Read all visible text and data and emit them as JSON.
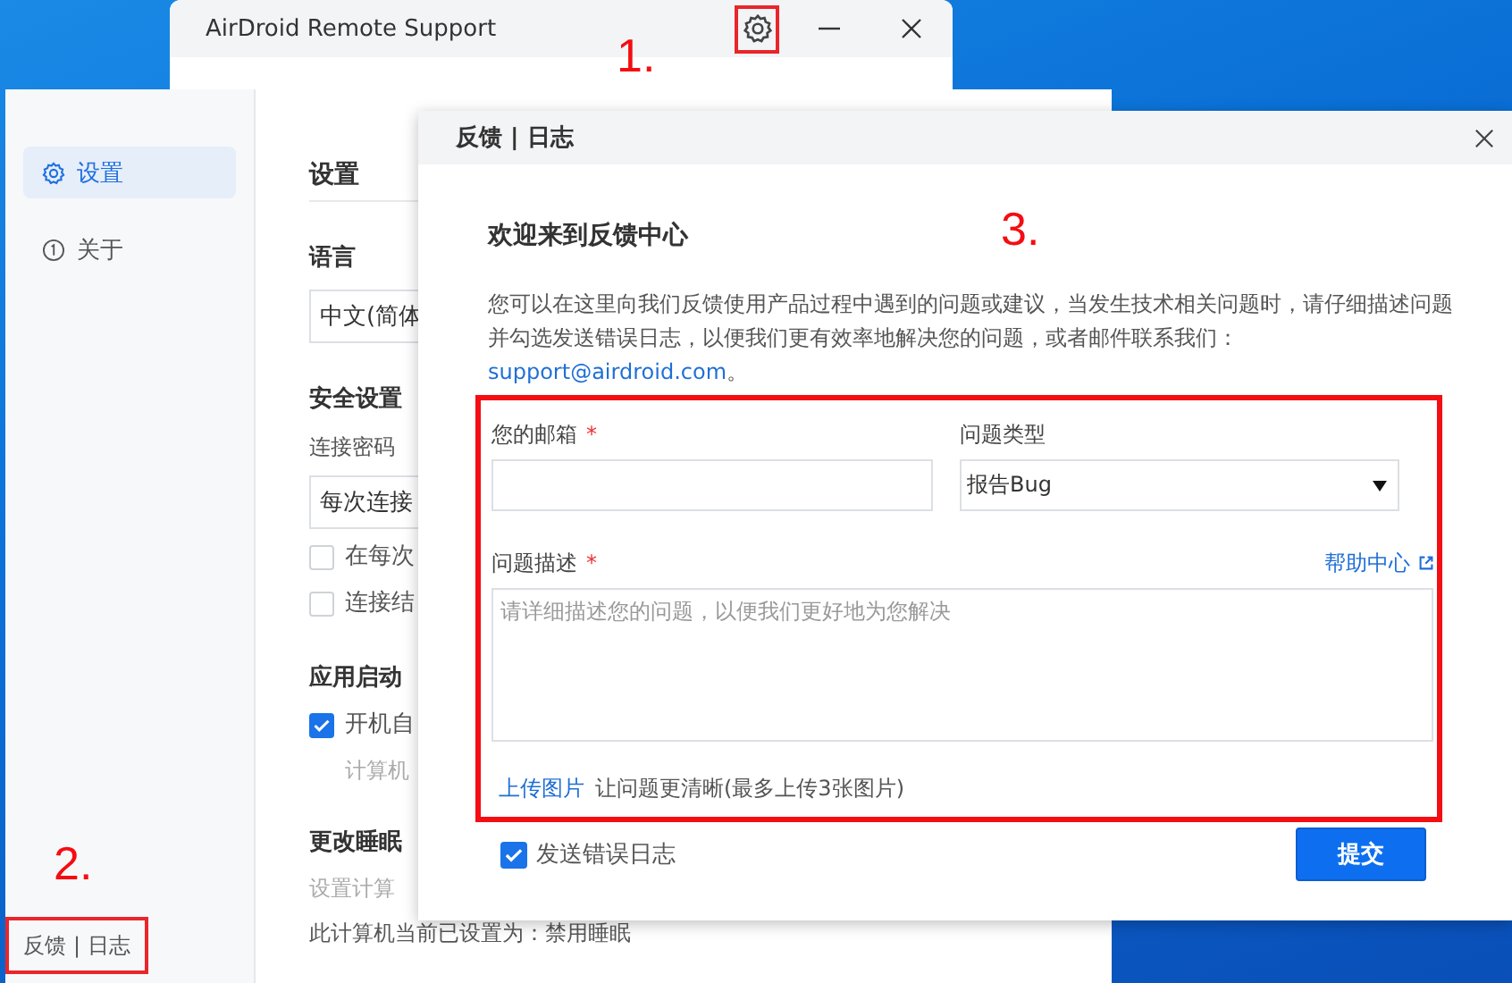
{
  "app_window": {
    "title": "AirDroid Remote Support"
  },
  "annotations": [
    {
      "label": "1."
    },
    {
      "label": "2."
    },
    {
      "label": "3."
    }
  ],
  "settings": {
    "sidebar": {
      "items": [
        {
          "label": "设置",
          "selected": true
        },
        {
          "label": "关于",
          "selected": false
        }
      ],
      "footer_link": "反馈 | 日志"
    },
    "content": [
      {
        "kind": "title",
        "text": "设置"
      },
      {
        "kind": "heading",
        "text": "语言"
      },
      {
        "kind": "select",
        "text": "中文(简体"
      },
      {
        "kind": "heading",
        "text": "安全设置"
      },
      {
        "kind": "text",
        "text": "连接密码"
      },
      {
        "kind": "select",
        "text": "每次连接"
      },
      {
        "kind": "checkbox",
        "text": "在每次",
        "checked": false
      },
      {
        "kind": "checkbox",
        "text": "连接结",
        "checked": false
      },
      {
        "kind": "heading",
        "text": "应用启动"
      },
      {
        "kind": "checkbox",
        "text": "开机自",
        "checked": true
      },
      {
        "kind": "hint",
        "text": "计算机"
      },
      {
        "kind": "heading",
        "text": "更改睡眠"
      },
      {
        "kind": "hint",
        "text": "设置计算"
      },
      {
        "kind": "text",
        "text": "此计算机当前已设置为：禁用睡眠"
      }
    ]
  },
  "feedback_dialog": {
    "title": "反馈 | 日志",
    "heading": "欢迎来到反馈中心",
    "intro": "您可以在这里向我们反馈使用产品过程中遇到的问题或建议，当发生技术相关问题时，请仔细描述问题并勾选发送错误日志，以便我们更有效率地解决您的问题，或者邮件联系我们：",
    "email_link": "support@airdroid.com",
    "intro_end": "。",
    "email_field": {
      "label": "您的邮箱",
      "required_mark": "*"
    },
    "type_field": {
      "label": "问题类型",
      "value": "报告Bug"
    },
    "description_field": {
      "label": "问题描述",
      "required_mark": "*",
      "placeholder": "请详细描述您的问题，以便我们更好地为您解决"
    },
    "help_link": "帮助中心",
    "upload_link": "上传图片",
    "upload_hint": "让问题更清晰(最多上传3张图片)",
    "send_log": {
      "label": "发送错误日志",
      "checked": true
    },
    "submit": "提交"
  }
}
